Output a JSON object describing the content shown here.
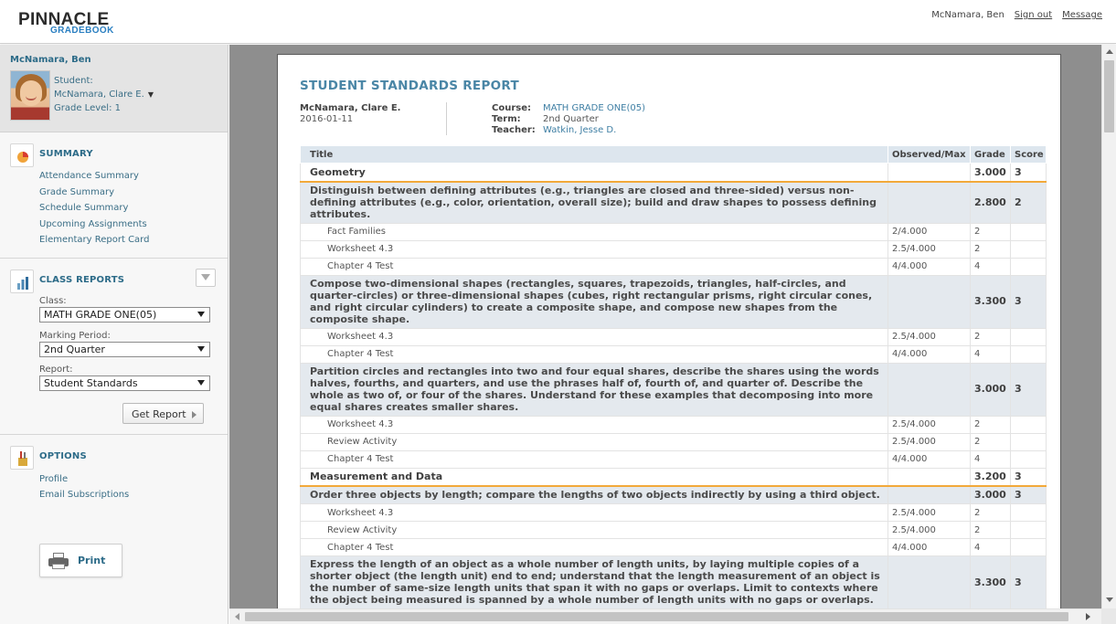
{
  "logo": {
    "main": "PINNACLE",
    "sub": "GRADEBOOK"
  },
  "header": {
    "user_name": "McNamara, Ben",
    "sign_out": "Sign out",
    "message": "Message"
  },
  "sidebar": {
    "user_name": "McNamara, Ben",
    "student_label": "Student:",
    "student_name": "McNamara, Clare E.",
    "grade_level": "Grade Level: 1",
    "summary": {
      "title": "SUMMARY",
      "links": [
        "Attendance Summary",
        "Grade Summary",
        "Schedule Summary",
        "Upcoming Assignments",
        "Elementary Report Card"
      ]
    },
    "class_reports": {
      "title": "CLASS REPORTS",
      "class_label": "Class:",
      "class_value": "MATH GRADE ONE(05)",
      "period_label": "Marking Period:",
      "period_value": "2nd Quarter",
      "report_label": "Report:",
      "report_value": "Student Standards",
      "get_report": "Get Report"
    },
    "options": {
      "title": "OPTIONS",
      "links": [
        "Profile",
        "Email Subscriptions"
      ],
      "print": "Print"
    }
  },
  "report": {
    "title": "STUDENT STANDARDS REPORT",
    "student": "McNamara, Clare E.",
    "date": "2016-01-11",
    "course_label": "Course:",
    "course": "MATH GRADE ONE(05)",
    "term_label": "Term:",
    "term": "2nd Quarter",
    "teacher_label": "Teacher:",
    "teacher": "Watkin, Jesse D.",
    "columns": [
      "Title",
      "Observed/Max",
      "Grade",
      "Score"
    ],
    "rows": [
      {
        "type": "cat",
        "title": "Geometry",
        "observed": "",
        "grade": "3.000",
        "score": "3"
      },
      {
        "type": "std",
        "title": "Distinguish between defining attributes (e.g., triangles are closed and three-sided) versus non-defining attributes (e.g., color, orientation, overall size); build and draw shapes to possess defining attributes.",
        "observed": "",
        "grade": "2.800",
        "score": "2"
      },
      {
        "type": "asg",
        "title": "Fact Families",
        "observed": "2/4.000",
        "grade": "2",
        "score": ""
      },
      {
        "type": "asg",
        "title": "Worksheet 4.3",
        "observed": "2.5/4.000",
        "grade": "2",
        "score": ""
      },
      {
        "type": "asg",
        "title": "Chapter 4 Test",
        "observed": "4/4.000",
        "grade": "4",
        "score": ""
      },
      {
        "type": "std",
        "title": "Compose two-dimensional shapes (rectangles, squares, trapezoids, triangles, half-circles, and quarter-circles) or three-dimensional shapes (cubes, right rectangular prisms, right circular cones, and right circular cylinders) to create a composite shape, and compose new shapes from the composite shape.",
        "observed": "",
        "grade": "3.300",
        "score": "3"
      },
      {
        "type": "asg",
        "title": "Worksheet 4.3",
        "observed": "2.5/4.000",
        "grade": "2",
        "score": ""
      },
      {
        "type": "asg",
        "title": "Chapter 4 Test",
        "observed": "4/4.000",
        "grade": "4",
        "score": ""
      },
      {
        "type": "std",
        "title": "Partition circles and rectangles into two and four equal shares, describe the shares using the words halves, fourths, and quarters, and use the phrases half of, fourth of, and quarter of. Describe the whole as two of, or four of the shares. Understand for these examples that decomposing into more equal shares creates smaller shares.",
        "observed": "",
        "grade": "3.000",
        "score": "3"
      },
      {
        "type": "asg",
        "title": "Worksheet 4.3",
        "observed": "2.5/4.000",
        "grade": "2",
        "score": ""
      },
      {
        "type": "asg",
        "title": "Review Activity",
        "observed": "2.5/4.000",
        "grade": "2",
        "score": ""
      },
      {
        "type": "asg",
        "title": "Chapter 4 Test",
        "observed": "4/4.000",
        "grade": "4",
        "score": ""
      },
      {
        "type": "cat",
        "title": "Measurement and Data",
        "observed": "",
        "grade": "3.200",
        "score": "3"
      },
      {
        "type": "std",
        "title": "Order three objects by length; compare the lengths of two objects indirectly by using a third object.",
        "observed": "",
        "grade": "3.000",
        "score": "3"
      },
      {
        "type": "asg",
        "title": "Worksheet 4.3",
        "observed": "2.5/4.000",
        "grade": "2",
        "score": ""
      },
      {
        "type": "asg",
        "title": "Review Activity",
        "observed": "2.5/4.000",
        "grade": "2",
        "score": ""
      },
      {
        "type": "asg",
        "title": "Chapter 4 Test",
        "observed": "4/4.000",
        "grade": "4",
        "score": ""
      },
      {
        "type": "std",
        "title": "Express the length of an object as a whole number of length units, by laying multiple copies of a shorter object (the length unit) end to end; understand that the length measurement of an object is the number of same-size length units that span it with no gaps or overlaps. Limit to contexts where the object being measured is spanned by a whole number of length units with no gaps or overlaps.",
        "observed": "",
        "grade": "3.300",
        "score": "3"
      }
    ]
  }
}
